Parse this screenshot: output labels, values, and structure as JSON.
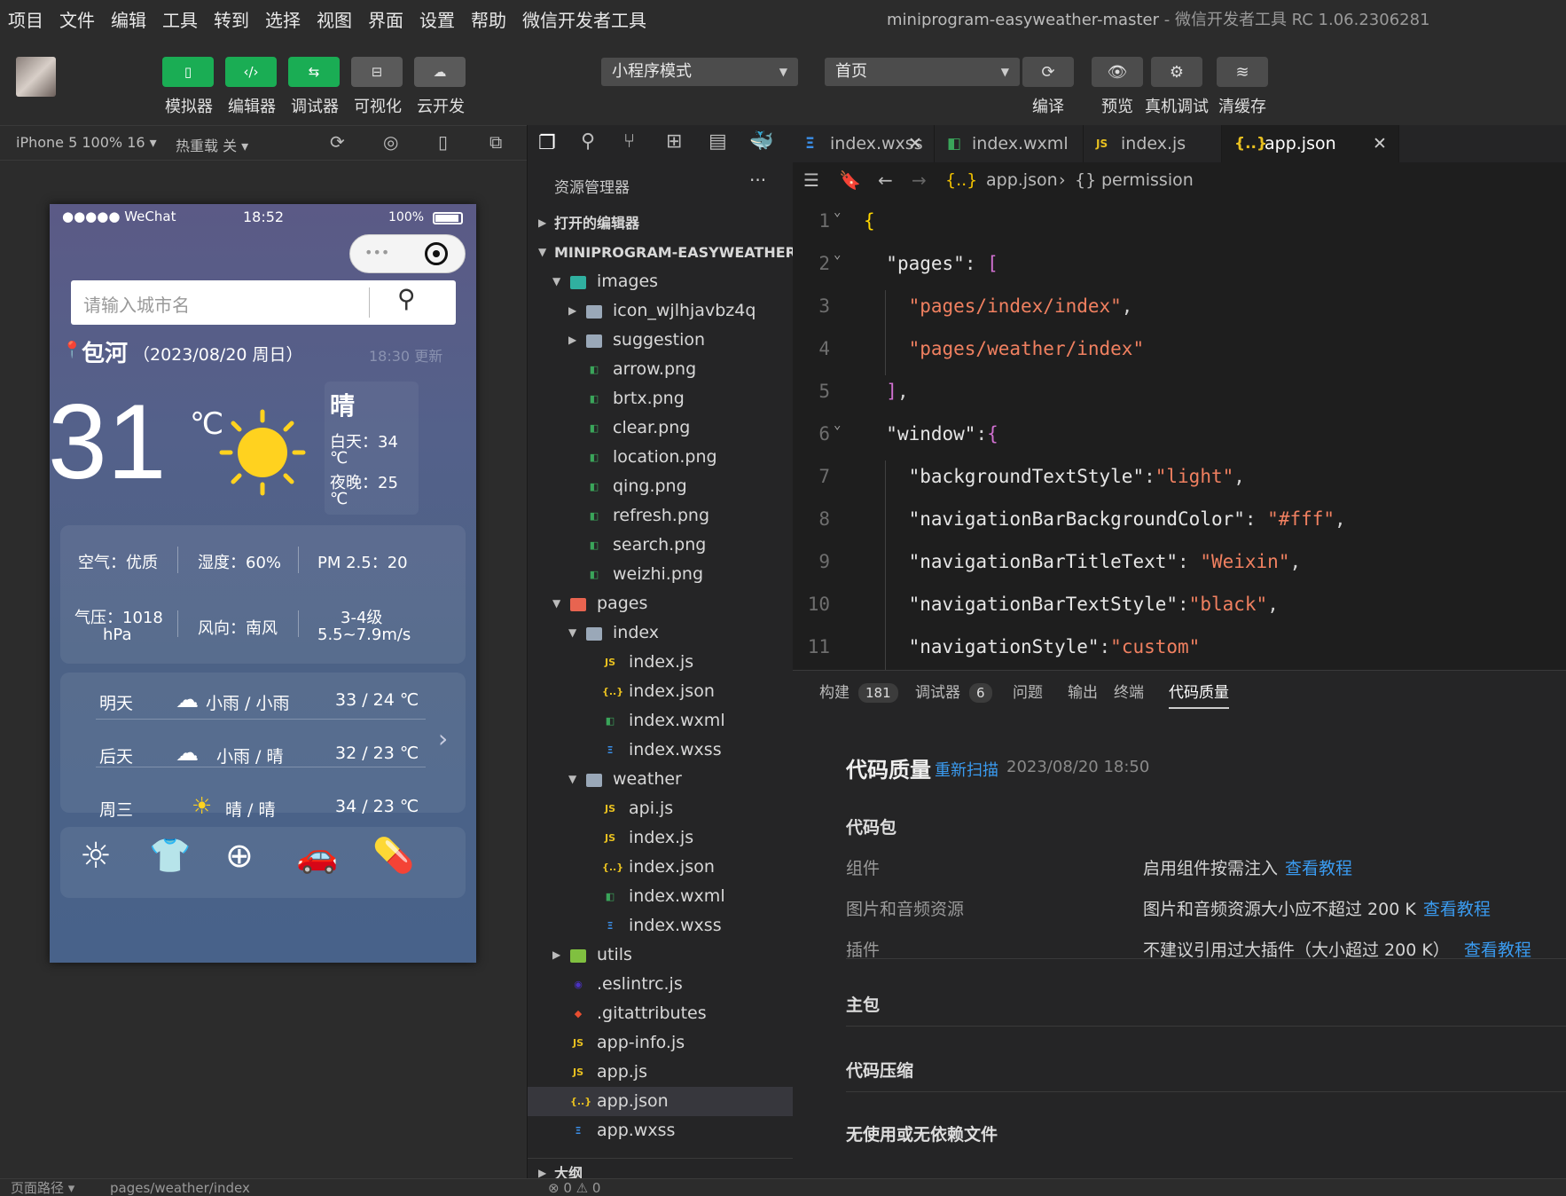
{
  "menubar": {
    "items": [
      "项目",
      "文件",
      "编辑",
      "工具",
      "转到",
      "选择",
      "视图",
      "界面",
      "设置",
      "帮助",
      "微信开发者工具"
    ],
    "title": "miniprogram-easyweather-master",
    "title_suffix": " - 微信开发者工具 RC 1.06.2306281"
  },
  "toolbar": {
    "left_buttons": [
      {
        "label": "模拟器",
        "icon": "phone-icon",
        "style": "green"
      },
      {
        "label": "编辑器",
        "icon": "code-icon",
        "style": "green"
      },
      {
        "label": "调试器",
        "icon": "debug-icon",
        "style": "green"
      },
      {
        "label": "可视化",
        "icon": "layout-icon",
        "style": "gray"
      },
      {
        "label": "云开发",
        "icon": "cloud-icon",
        "style": "gray"
      }
    ],
    "mode_select": "小程序模式",
    "page_select": "首页",
    "right_buttons": [
      {
        "label": "编译",
        "icon": "refresh-icon"
      },
      {
        "label": "预览",
        "icon": "eye-icon"
      },
      {
        "label": "真机调试",
        "icon": "bug-icon"
      },
      {
        "label": "清缓存",
        "icon": "layers-icon"
      }
    ]
  },
  "simulator_bar": {
    "device": "iPhone 5 100% 16 ▾",
    "hot_reload": "热重载 关 ▾"
  },
  "phone": {
    "status": {
      "carrier": "●●●●● WeChat",
      "time": "18:52",
      "battery": "100%"
    },
    "search_placeholder": "请输入城市名",
    "city": "包河",
    "date": "（2023/08/20 周日）",
    "updated": "18:30 更新",
    "temperature": "31",
    "temp_unit": "℃",
    "condition": "晴",
    "day_temp": "白天：34",
    "day_unit": "℃",
    "night_temp": "夜晚：25",
    "night_unit": "℃",
    "stats": {
      "air": "空气：优质",
      "humidity": "湿度：60%",
      "pm": "PM 2.5：20",
      "pressure_1": "气压：1018",
      "pressure_2": "hPa",
      "wind": "风向：南风",
      "wind_level": "3-4级",
      "wind_speed": "5.5~7.9m/s"
    },
    "forecast": [
      {
        "day": "明天",
        "weather": "小雨 / 小雨",
        "temp": "33 / 24 ℃"
      },
      {
        "day": "后天",
        "weather": "小雨 / 晴",
        "temp": "32 / 23 ℃"
      },
      {
        "day": "周三",
        "weather": "晴 / 晴",
        "temp": "34 / 23 ℃"
      }
    ]
  },
  "explorer": {
    "title": "资源管理器",
    "open_editors": "打开的编辑器",
    "project": "MINIPROGRAM-EASYWEATHER...",
    "outline": "大纲",
    "tree": [
      {
        "name": "images",
        "type": "folder-img",
        "depth": 1,
        "open": true
      },
      {
        "name": "icon_wjlhjavbz4q",
        "type": "folder",
        "depth": 2,
        "open": false
      },
      {
        "name": "suggestion",
        "type": "folder",
        "depth": 2,
        "open": false
      },
      {
        "name": "arrow.png",
        "type": "img",
        "depth": 2
      },
      {
        "name": "brtx.png",
        "type": "img",
        "depth": 2
      },
      {
        "name": "clear.png",
        "type": "img",
        "depth": 2
      },
      {
        "name": "location.png",
        "type": "img",
        "depth": 2
      },
      {
        "name": "qing.png",
        "type": "img",
        "depth": 2
      },
      {
        "name": "refresh.png",
        "type": "img",
        "depth": 2
      },
      {
        "name": "search.png",
        "type": "img",
        "depth": 2
      },
      {
        "name": "weizhi.png",
        "type": "img",
        "depth": 2
      },
      {
        "name": "pages",
        "type": "folder-pages",
        "depth": 1,
        "open": true
      },
      {
        "name": "index",
        "type": "folder",
        "depth": 2,
        "open": true
      },
      {
        "name": "index.js",
        "type": "js",
        "depth": 3
      },
      {
        "name": "index.json",
        "type": "json",
        "depth": 3
      },
      {
        "name": "index.wxml",
        "type": "wxml",
        "depth": 3
      },
      {
        "name": "index.wxss",
        "type": "wxss",
        "depth": 3
      },
      {
        "name": "weather",
        "type": "folder",
        "depth": 2,
        "open": true
      },
      {
        "name": "api.js",
        "type": "js",
        "depth": 3
      },
      {
        "name": "index.js",
        "type": "js",
        "depth": 3
      },
      {
        "name": "index.json",
        "type": "json",
        "depth": 3
      },
      {
        "name": "index.wxml",
        "type": "wxml",
        "depth": 3
      },
      {
        "name": "index.wxss",
        "type": "wxss",
        "depth": 3
      },
      {
        "name": "utils",
        "type": "folder-utils",
        "depth": 1,
        "open": false
      },
      {
        "name": ".eslintrc.js",
        "type": "eslint",
        "depth": 1
      },
      {
        "name": ".gitattributes",
        "type": "git",
        "depth": 1
      },
      {
        "name": "app-info.js",
        "type": "js",
        "depth": 1
      },
      {
        "name": "app.js",
        "type": "js",
        "depth": 1
      },
      {
        "name": "app.json",
        "type": "json",
        "depth": 1,
        "selected": true
      },
      {
        "name": "app.wxss",
        "type": "wxss",
        "depth": 1
      }
    ]
  },
  "editor": {
    "tabs": [
      {
        "name": "index.wxss",
        "type": "wxss",
        "closable": true
      },
      {
        "name": "index.wxml",
        "type": "wxml"
      },
      {
        "name": "index.js",
        "type": "js"
      },
      {
        "name": "app.json",
        "type": "json",
        "active": true,
        "closable": true
      }
    ],
    "breadcrumb": [
      "app.json",
      "permission"
    ],
    "lines": [
      {
        "n": "1",
        "html": "<span class='b'>{</span>"
      },
      {
        "n": "2",
        "html": "  <span class='k'>\"pages\"</span><span class='p'>: </span><span class='pb'>[</span>"
      },
      {
        "n": "3",
        "html": "    <span class='s'>\"pages/index/index\"</span><span class='p'>,</span>"
      },
      {
        "n": "4",
        "html": "    <span class='s'>\"pages/weather/index\"</span>"
      },
      {
        "n": "5",
        "html": "  <span class='pb'>]</span><span class='p'>,</span>"
      },
      {
        "n": "6",
        "html": "  <span class='k'>\"window\"</span><span class='p'>:</span><span class='pb'>{</span>"
      },
      {
        "n": "7",
        "html": "    <span class='k'>\"backgroundTextStyle\"</span><span class='p'>:</span><span class='s'>\"light\"</span><span class='p'>,</span>"
      },
      {
        "n": "8",
        "html": "    <span class='k'>\"navigationBarBackgroundColor\"</span><span class='p'>: </span><span class='s'>\"#fff\"</span><span class='p'>,</span>"
      },
      {
        "n": "9",
        "html": "    <span class='k'>\"navigationBarTitleText\"</span><span class='p'>: </span><span class='s'>\"Weixin\"</span><span class='p'>,</span>"
      },
      {
        "n": "10",
        "html": "    <span class='k'>\"navigationBarTextStyle\"</span><span class='p'>:</span><span class='s'>\"black\"</span><span class='p'>,</span>"
      },
      {
        "n": "11",
        "html": "    <span class='k'>\"navigationStyle\"</span><span class='p'>:</span><span class='s'>\"custom\"</span>"
      }
    ]
  },
  "panel": {
    "tabs": [
      {
        "label": "构建",
        "badge": "181"
      },
      {
        "label": "调试器",
        "badge": "6"
      },
      {
        "label": "问题"
      },
      {
        "label": "输出"
      },
      {
        "label": "终端"
      },
      {
        "label": "代码质量",
        "active": true
      }
    ],
    "heading": "代码质量",
    "rescan": "重新扫描",
    "scan_time": "2023/08/20 18:50",
    "section_pkg": "代码包",
    "rows": [
      {
        "label": "组件",
        "value": "启用组件按需注入",
        "link": "查看教程"
      },
      {
        "label": "图片和音频资源",
        "value": "图片和音频资源大小应不超过 200 K",
        "link": "查看教程"
      },
      {
        "label": "插件",
        "value": "不建议引用过大插件（大小超过 200 K）",
        "link": "查看教程"
      }
    ],
    "section_main": "主包",
    "section_compress": "代码压缩",
    "section_unused": "无使用或无依赖文件"
  },
  "statusbar": {
    "path_label": "页面路径 ▾",
    "path": "pages/weather/index",
    "errors": "⊗ 0 ⚠ 0"
  }
}
